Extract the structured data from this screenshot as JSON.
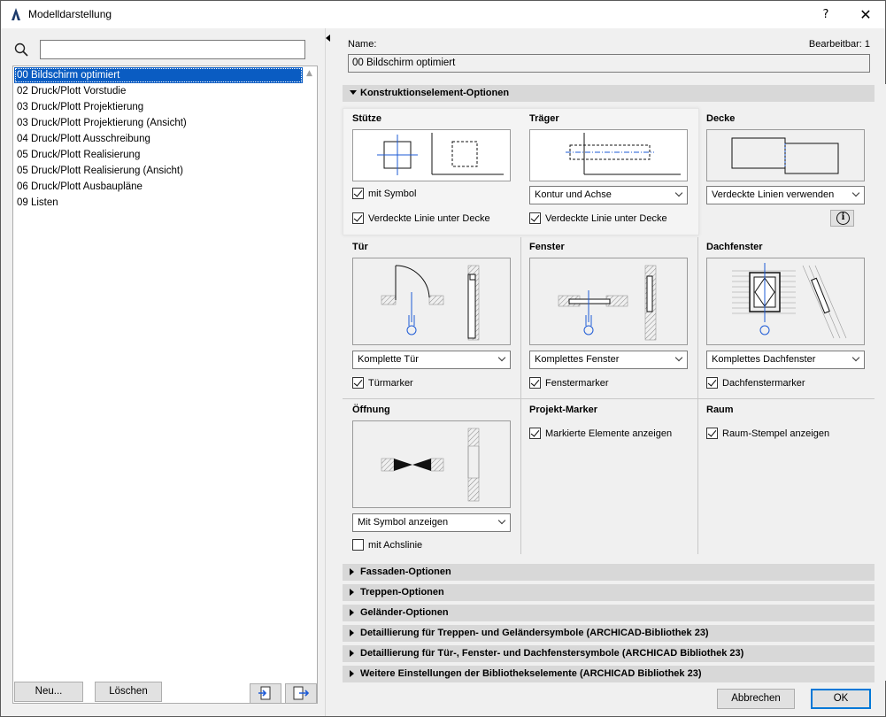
{
  "window": {
    "title": "Modelldarstellung",
    "help": "?",
    "close": "✕"
  },
  "left": {
    "search_placeholder": "",
    "items": [
      "00 Bildschirm optimiert",
      "02 Druck/Plott Vorstudie",
      "03 Druck/Plott Projektierung",
      "03 Druck/Plott Projektierung (Ansicht)",
      "04 Druck/Plott Ausschreibung",
      "05 Druck/Plott Realisierung",
      "05 Druck/Plott Realisierung (Ansicht)",
      "06 Druck/Plott Ausbaupläne",
      "09 Listen"
    ],
    "selected_index": 0,
    "new_button": "Neu...",
    "delete_button": "Löschen"
  },
  "right": {
    "name_label": "Name:",
    "editable_label": "Bearbeitbar: 1",
    "name_value": "00 Bildschirm optimiert",
    "section_main": "Konstruktionselement-Optionen",
    "stuetze": {
      "title": "Stütze",
      "check1": "mit Symbol",
      "check2": "Verdeckte Linie unter Decke"
    },
    "traeger": {
      "title": "Träger",
      "dropdown": "Kontur und Achse",
      "check": "Verdeckte Linie unter Decke"
    },
    "decke": {
      "title": "Decke",
      "dropdown": "Verdeckte Linien verwenden"
    },
    "tuer": {
      "title": "Tür",
      "dropdown": "Komplette Tür",
      "check": "Türmarker"
    },
    "fenster": {
      "title": "Fenster",
      "dropdown": "Komplettes Fenster",
      "check": "Fenstermarker"
    },
    "dachfenster": {
      "title": "Dachfenster",
      "dropdown": "Komplettes Dachfenster",
      "check": "Dachfenstermarker"
    },
    "oeffnung": {
      "title": "Öffnung",
      "dropdown": "Mit Symbol anzeigen",
      "check": "mit Achslinie"
    },
    "projektmarker": {
      "title": "Projekt-Marker",
      "check": "Markierte Elemente anzeigen"
    },
    "raum": {
      "title": "Raum",
      "check": "Raum-Stempel anzeigen"
    },
    "collapsed_sections": [
      "Fassaden-Optionen",
      "Treppen-Optionen",
      "Geländer-Optionen",
      "Detaillierung für Treppen- und Geländersymbole (ARCHICAD-Bibliothek 23)",
      "Detaillierung für Tür-, Fenster- und Dachfenstersymbole (ARCHICAD Bibliothek 23)",
      "Weitere Einstellungen der Bibliothekselemente (ARCHICAD Bibliothek 23)"
    ],
    "cancel_button": "Abbrechen",
    "ok_button": "OK"
  },
  "colors": {
    "selection": "#0a5cc2",
    "symbol_blue": "#1e5bd6",
    "section_bg": "#d8d8d8"
  }
}
